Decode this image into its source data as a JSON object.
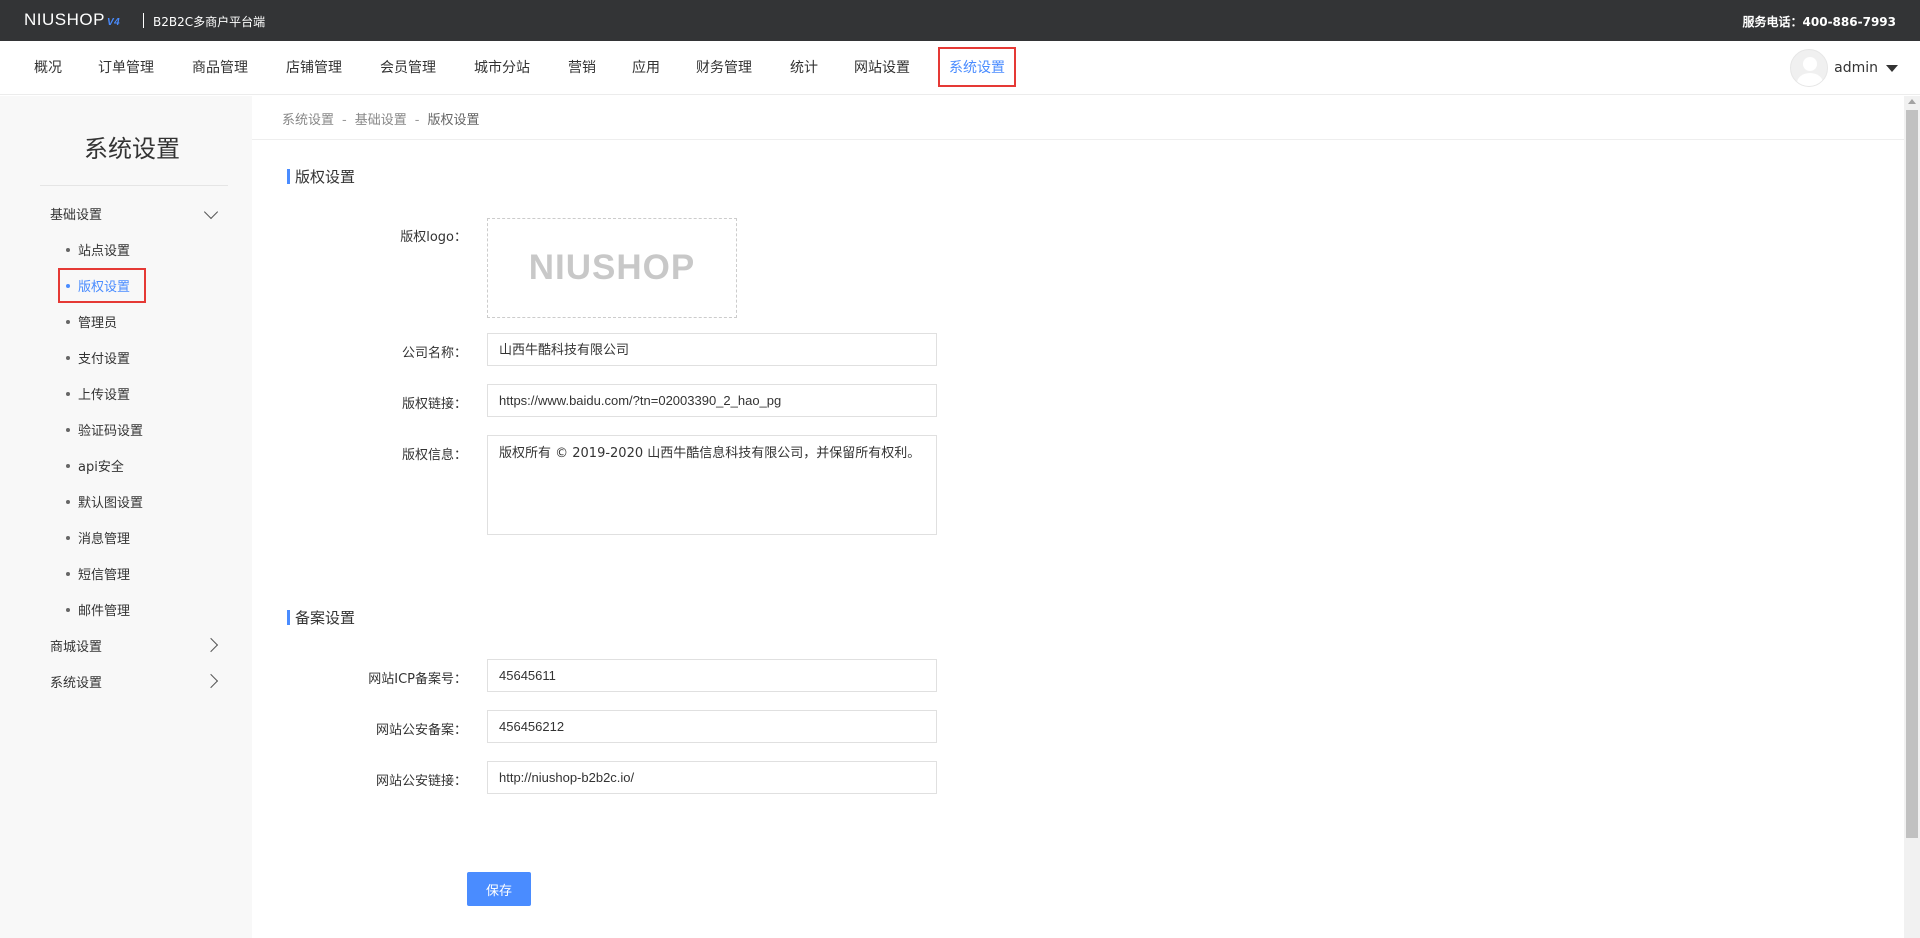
{
  "topbar": {
    "logo": "NIUSHOP",
    "logo_version": "V4",
    "platform": "B2B2C多商户平台端",
    "hotline": "服务电话：400-886-7993"
  },
  "nav": {
    "items": [
      "概况",
      "订单管理",
      "商品管理",
      "店铺管理",
      "会员管理",
      "城市分站",
      "营销",
      "应用",
      "财务管理",
      "统计",
      "网站设置",
      "系统设置"
    ],
    "active_index": 11,
    "user": "admin"
  },
  "sidebar": {
    "title": "系统设置",
    "groups": [
      {
        "label": "基础设置",
        "expanded": true
      },
      {
        "label": "商城设置",
        "expanded": false
      },
      {
        "label": "系统设置",
        "expanded": false
      }
    ],
    "sub_items": [
      "站点设置",
      "版权设置",
      "管理员",
      "支付设置",
      "上传设置",
      "验证码设置",
      "api安全",
      "默认图设置",
      "消息管理",
      "短信管理",
      "邮件管理"
    ],
    "active_sub": "版权设置"
  },
  "breadcrumb": [
    "系统设置",
    "基础设置",
    "版权设置"
  ],
  "copyright": {
    "section_title": "版权设置",
    "logo_label": "版权logo：",
    "logo_text": "NIUSHOP",
    "company_label": "公司名称：",
    "company_value": "山西牛酷科技有限公司",
    "link_label": "版权链接：",
    "link_value": "https://www.baidu.com/?tn=02003390_2_hao_pg",
    "info_label": "版权信息：",
    "info_value": "版权所有 © 2019-2020 山西牛酷信息科技有限公司，并保留所有权利。"
  },
  "record": {
    "section_title": "备案设置",
    "icp_label": "网站ICP备案号：",
    "icp_value": "45645611",
    "police_label": "网站公安备案：",
    "police_value": "456456212",
    "police_link_label": "网站公安链接：",
    "police_link_value": "http://niushop-b2b2c.io/"
  },
  "save_label": "保存",
  "colors": {
    "accent": "#4a8cff",
    "highlight": "#e53935",
    "topbar": "#333436"
  }
}
